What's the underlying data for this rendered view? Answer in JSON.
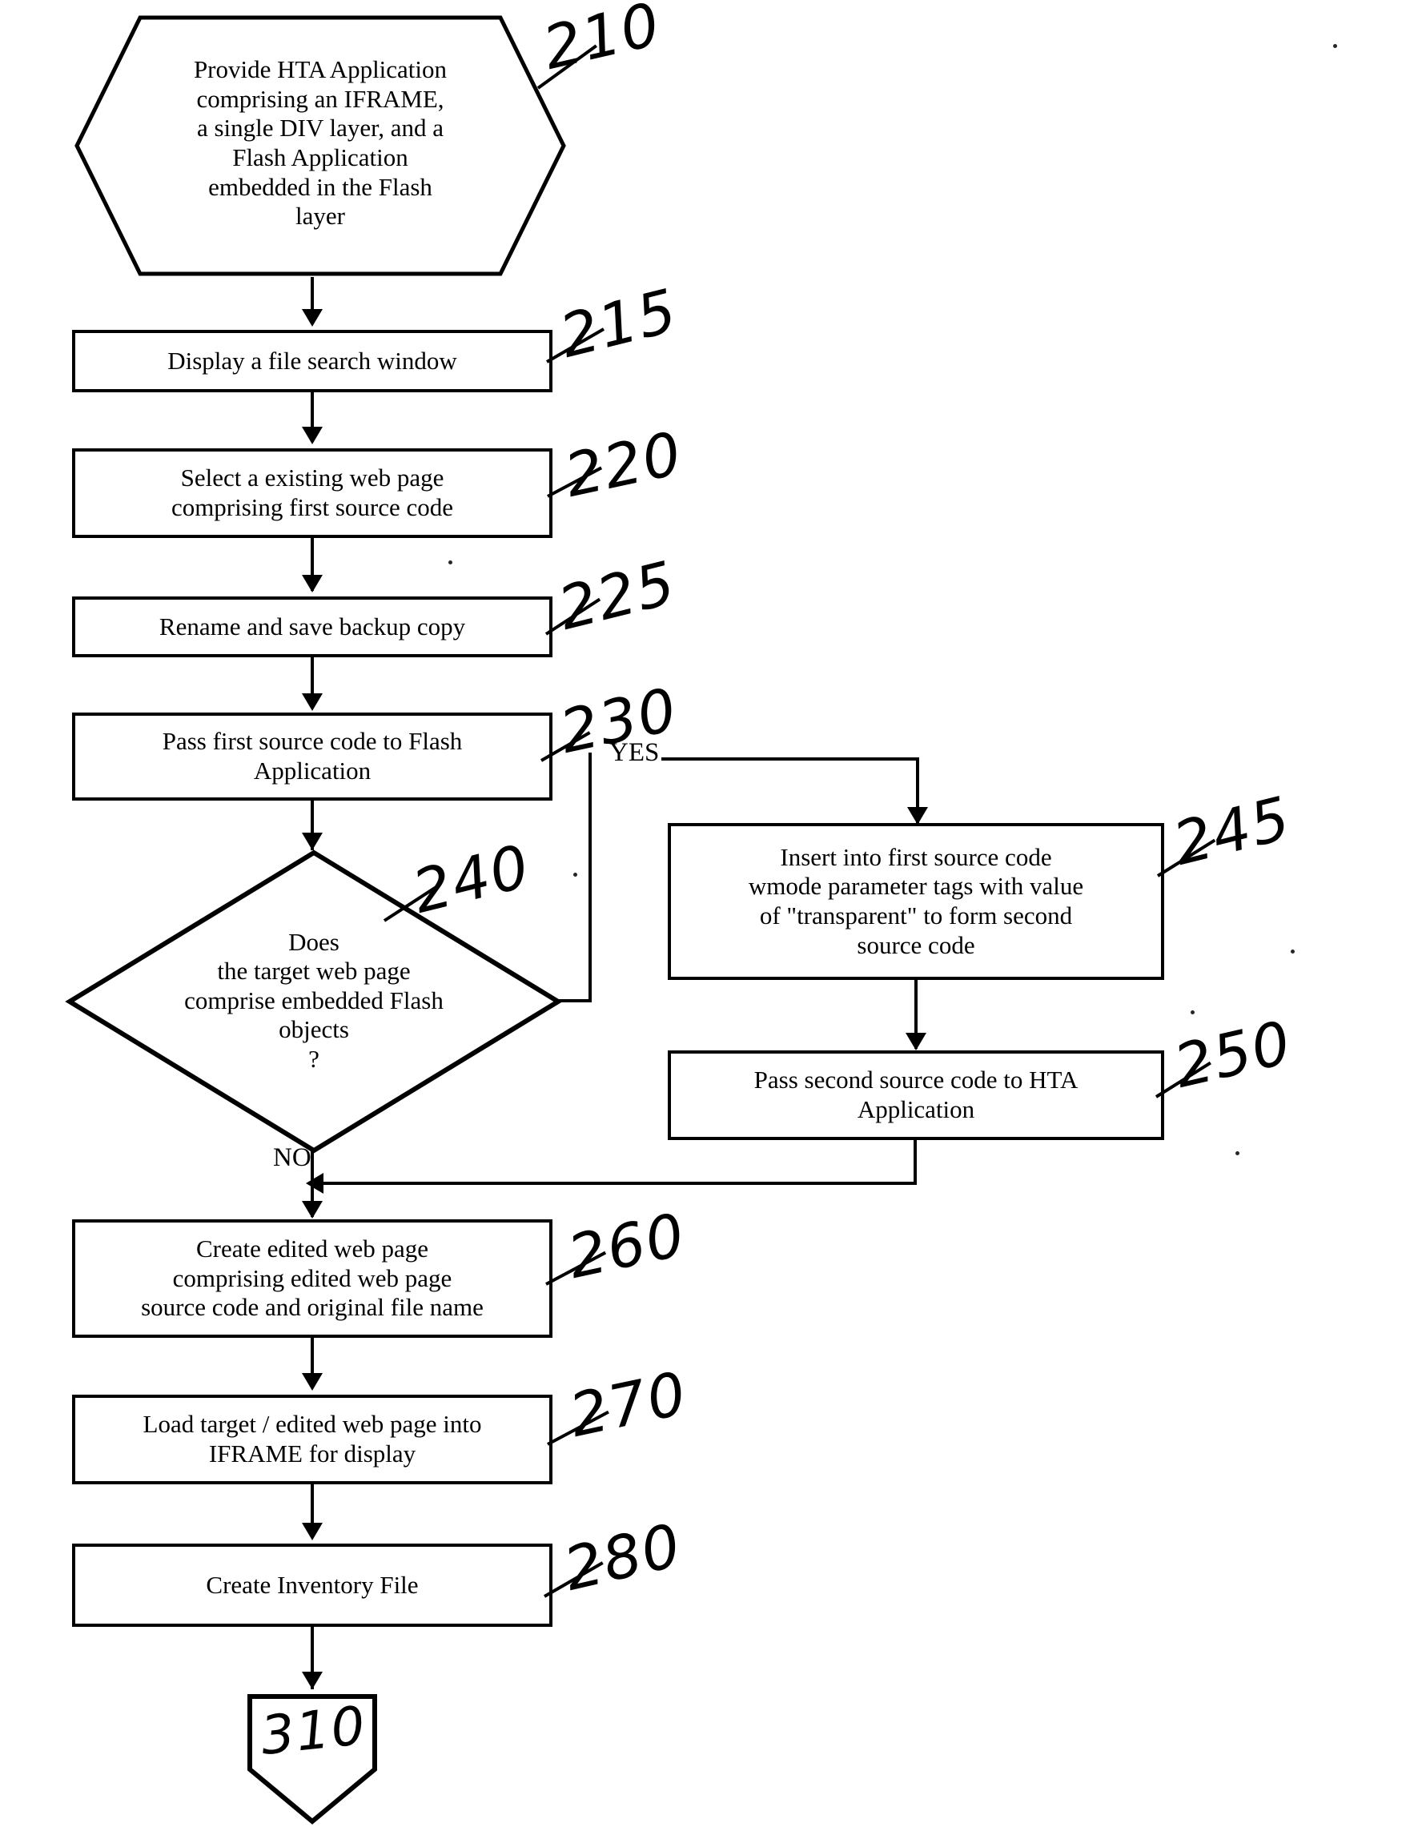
{
  "figure": {
    "type": "patent-flowchart",
    "background": "#ffffff",
    "ink": "#000000"
  },
  "nodes": [
    {
      "id": "n210",
      "shape": "hexagon",
      "ref": "210",
      "text": "Provide HTA Application comprising an IFRAME, a single DIV layer, and a Flash Application embedded in the Flash layer",
      "lines": [
        "Provide HTA Application",
        "comprising an IFRAME,",
        "a single DIV layer, and a",
        "Flash Application",
        "embedded in the Flash",
        "layer"
      ]
    },
    {
      "id": "n215",
      "shape": "rect",
      "ref": "215",
      "text": "Display a file search window",
      "lines": [
        "Display a file search window"
      ]
    },
    {
      "id": "n220",
      "shape": "rect",
      "ref": "220",
      "text": "Select a existing  web page comprising first source code",
      "lines": [
        "Select a existing  web page",
        "comprising first source code"
      ]
    },
    {
      "id": "n225",
      "shape": "rect",
      "ref": "225",
      "text": "Rename and save backup copy",
      "lines": [
        "Rename and save backup copy"
      ]
    },
    {
      "id": "n230",
      "shape": "rect",
      "ref": "230",
      "text": "Pass first source code to Flash Application",
      "lines": [
        "Pass first source code to Flash",
        "Application"
      ]
    },
    {
      "id": "n240",
      "shape": "diamond",
      "ref": "240",
      "text": "Does the target web page comprise embedded Flash objects ?",
      "lines": [
        "Does",
        "the target web page",
        "comprise embedded Flash",
        "objects",
        "?"
      ]
    },
    {
      "id": "n245",
      "shape": "rect",
      "ref": "245",
      "text": "Insert into first source code wmode parameter tags with value of \"transparent\" to form second source code",
      "lines": [
        "Insert into first source code",
        "wmode parameter tags with value",
        "of \"transparent\" to form second",
        "source code"
      ]
    },
    {
      "id": "n250",
      "shape": "rect",
      "ref": "250",
      "text": "Pass second source code to HTA Application",
      "lines": [
        "Pass second source code to HTA",
        "Application"
      ]
    },
    {
      "id": "n260",
      "shape": "rect",
      "ref": "260",
      "text": "Create edited web page comprising  edited web page source code and original file name",
      "lines": [
        "Create edited web page",
        "comprising  edited web page",
        "source code and original file name"
      ]
    },
    {
      "id": "n270",
      "shape": "rect",
      "ref": "270",
      "text": "Load target / edited web page into IFRAME for display",
      "lines": [
        "Load target / edited web page into",
        "IFRAME for display"
      ]
    },
    {
      "id": "n280",
      "shape": "rect",
      "ref": "280",
      "text": "Create Inventory File",
      "lines": [
        "Create Inventory File"
      ]
    },
    {
      "id": "n310",
      "shape": "pentagon-connector",
      "ref": "310",
      "text": "",
      "lines": []
    }
  ],
  "branch_labels": {
    "yes": "YES",
    "no": "NO"
  },
  "reference_numerals": {
    "n210": "210",
    "n215": "215",
    "n220": "220",
    "n225": "225",
    "n230": "230",
    "n240": "240",
    "n245": "245",
    "n250": "250",
    "n260": "260",
    "n270": "270",
    "n280": "280",
    "n310": "310"
  }
}
